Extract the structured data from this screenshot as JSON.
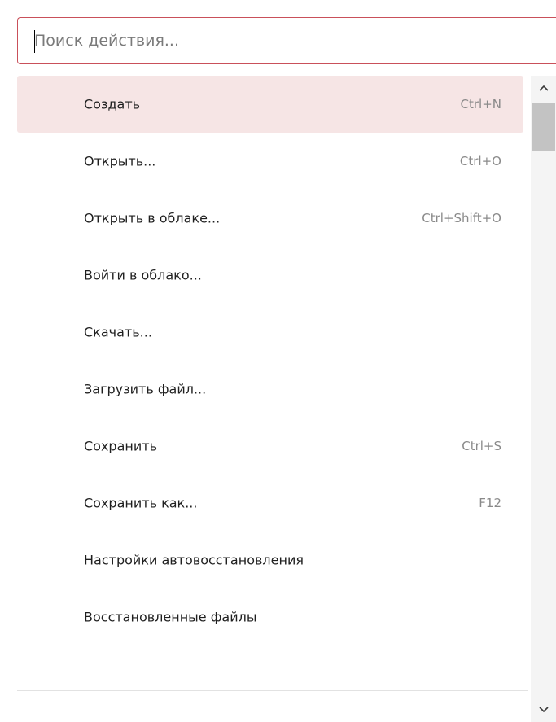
{
  "search": {
    "placeholder": "Поиск действия..."
  },
  "menu": {
    "items": [
      {
        "label": "Создать",
        "shortcut": "Ctrl+N",
        "selected": true
      },
      {
        "label": "Открыть...",
        "shortcut": "Ctrl+O"
      },
      {
        "label": "Открыть в облаке...",
        "shortcut": "Ctrl+Shift+O"
      },
      {
        "label": "Войти в облако...",
        "shortcut": ""
      },
      {
        "label": "Скачать...",
        "shortcut": ""
      },
      {
        "label": "Загрузить файл...",
        "shortcut": ""
      },
      {
        "label": "Сохранить",
        "shortcut": "Ctrl+S"
      },
      {
        "label": "Сохранить как...",
        "shortcut": "F12"
      },
      {
        "label": "Настройки автовосстановления",
        "shortcut": ""
      },
      {
        "label": "Восстановленные файлы",
        "shortcut": ""
      }
    ]
  },
  "scrollbar": {
    "up_icon": "chevron-up-icon",
    "down_icon": "chevron-down-icon"
  },
  "colors": {
    "accent_border": "#c9505a",
    "selected_background": "#f6e5e5"
  }
}
